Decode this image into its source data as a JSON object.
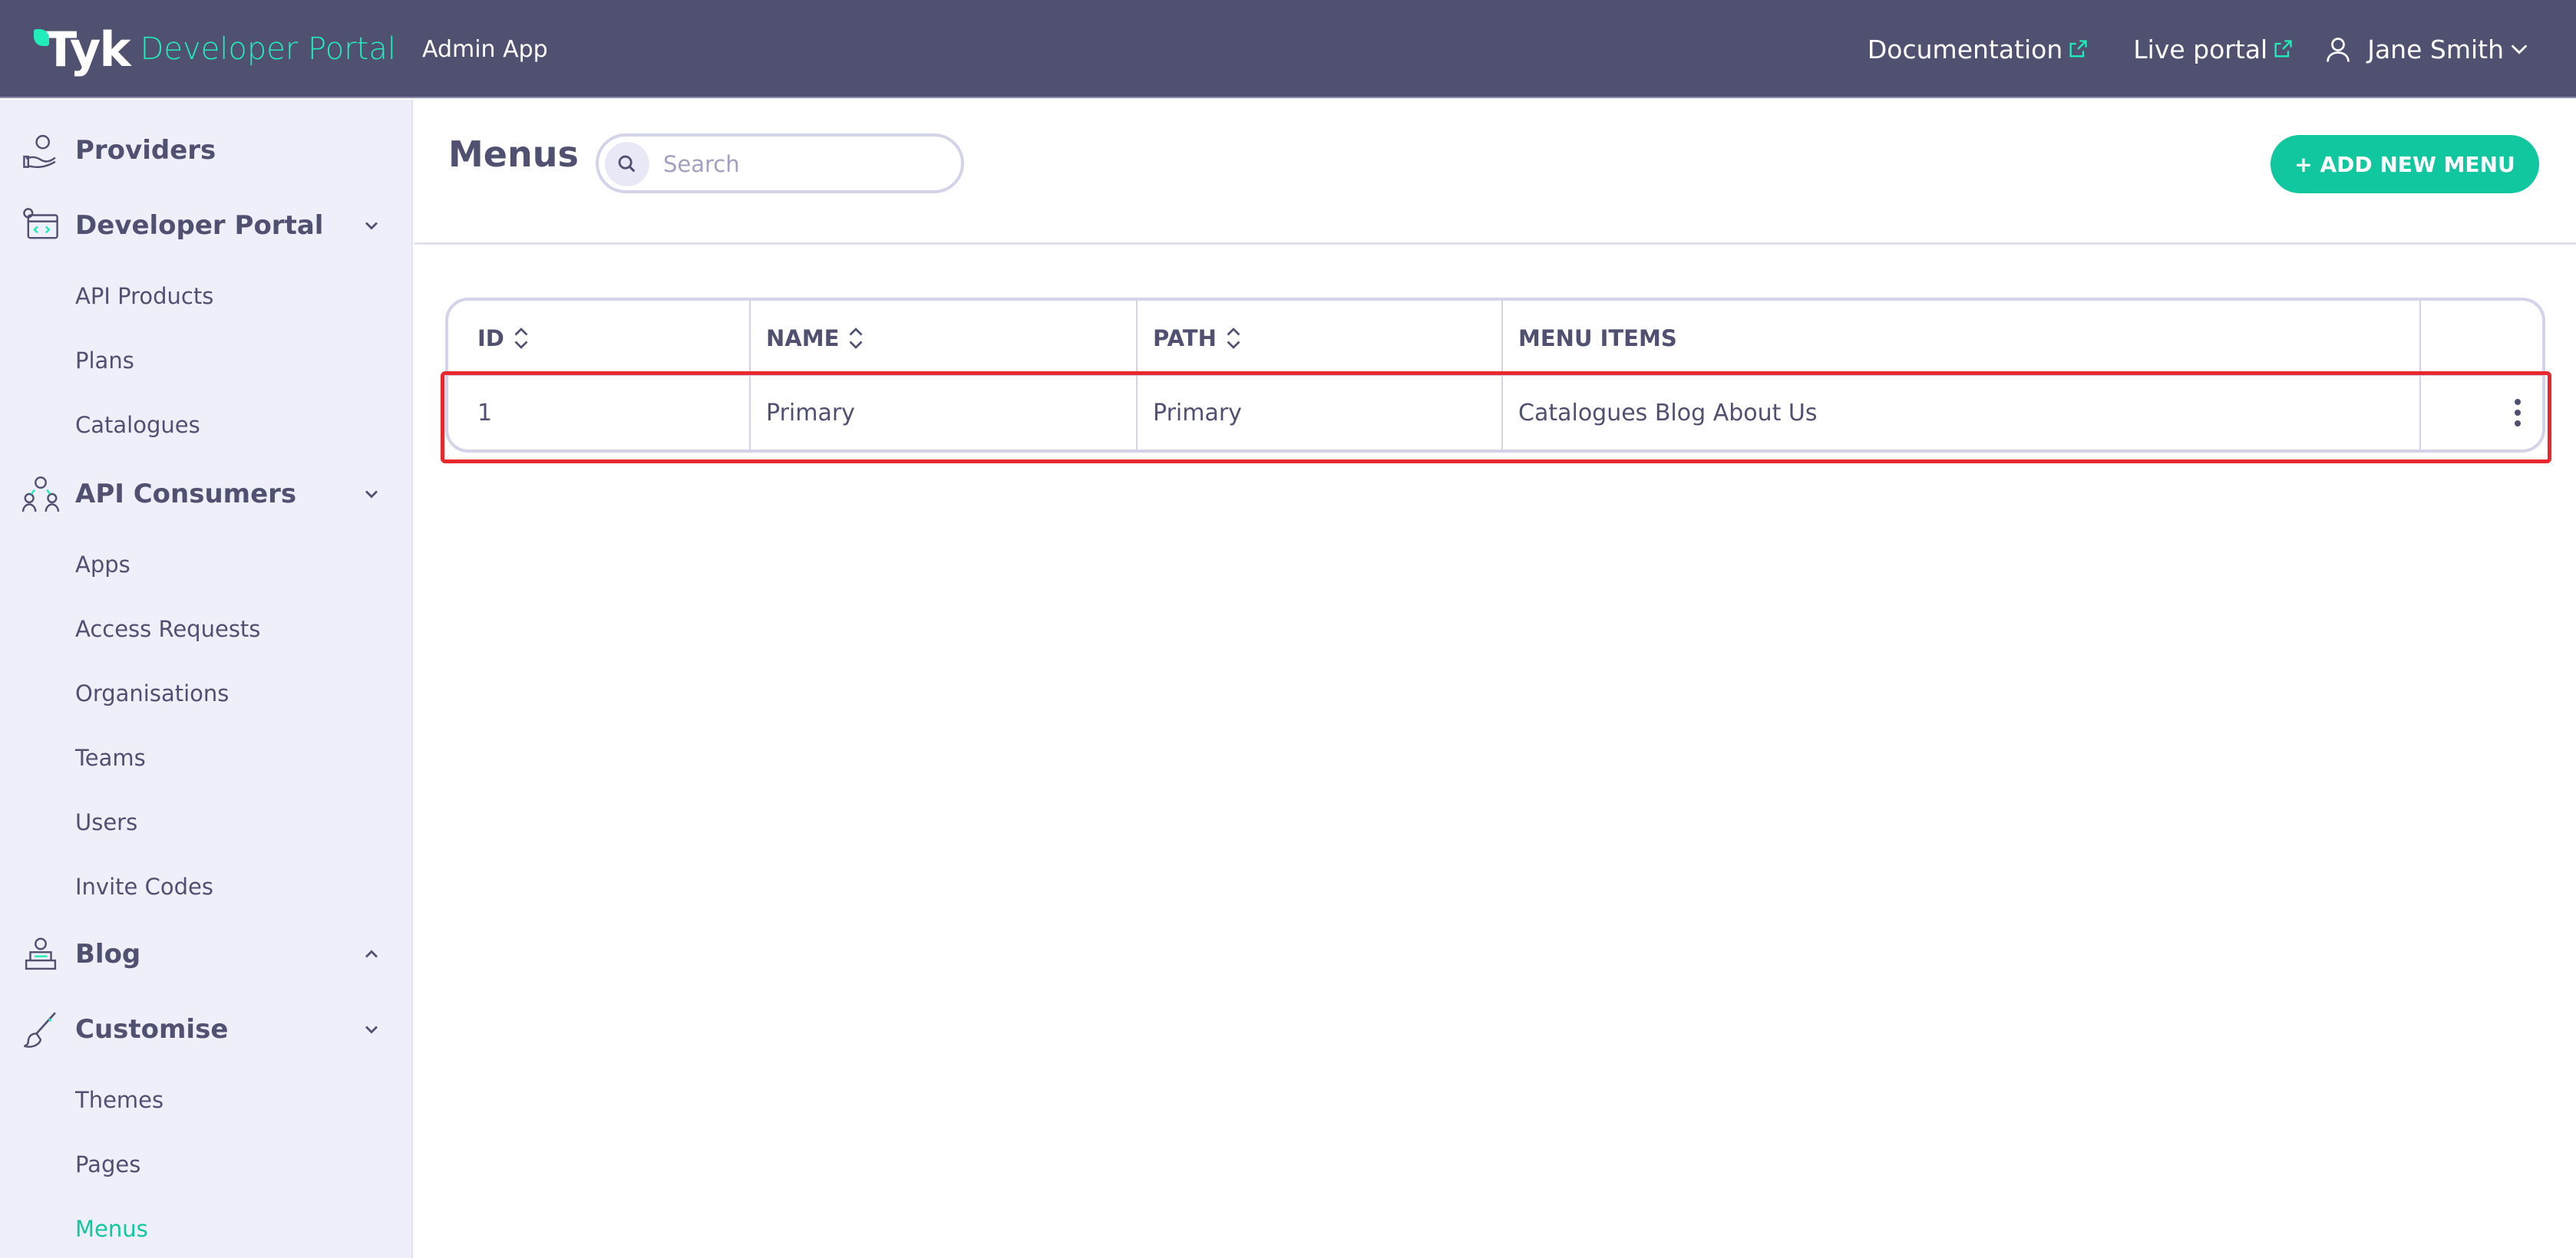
{
  "header": {
    "brand_logo": "Tyk",
    "brand_product": "Developer Portal",
    "app_label": "Admin App",
    "documentation_link": "Documentation",
    "live_portal_link": "Live portal",
    "user_name": "Jane Smith"
  },
  "sidebar": {
    "sections": [
      {
        "label": "Providers",
        "icon": "providers-icon"
      },
      {
        "label": "Developer Portal",
        "icon": "developer-portal-icon",
        "items": [
          "API Products",
          "Plans",
          "Catalogues"
        ]
      },
      {
        "label": "API Consumers",
        "icon": "api-consumers-icon",
        "items": [
          "Apps",
          "Access Requests",
          "Organisations",
          "Teams",
          "Users",
          "Invite Codes"
        ]
      },
      {
        "label": "Blog",
        "icon": "blog-icon"
      },
      {
        "label": "Customise",
        "icon": "customise-icon",
        "items": [
          "Themes",
          "Pages",
          "Menus"
        ]
      }
    ],
    "active_item": "Menus"
  },
  "main": {
    "title": "Menus",
    "search_placeholder": "Search",
    "add_button": "+ ADD NEW MENU",
    "table": {
      "columns": [
        "ID",
        "NAME",
        "PATH",
        "MENU ITEMS"
      ],
      "rows": [
        {
          "id": "1",
          "name": "Primary",
          "path": "Primary",
          "menu_items": "Catalogues Blog About Us"
        }
      ]
    }
  },
  "colors": {
    "header_bg": "#505071",
    "accent": "#11c7a0",
    "brand_green": "#20edba",
    "sidebar_bg": "#efeff9",
    "highlight": "#e8282d"
  }
}
